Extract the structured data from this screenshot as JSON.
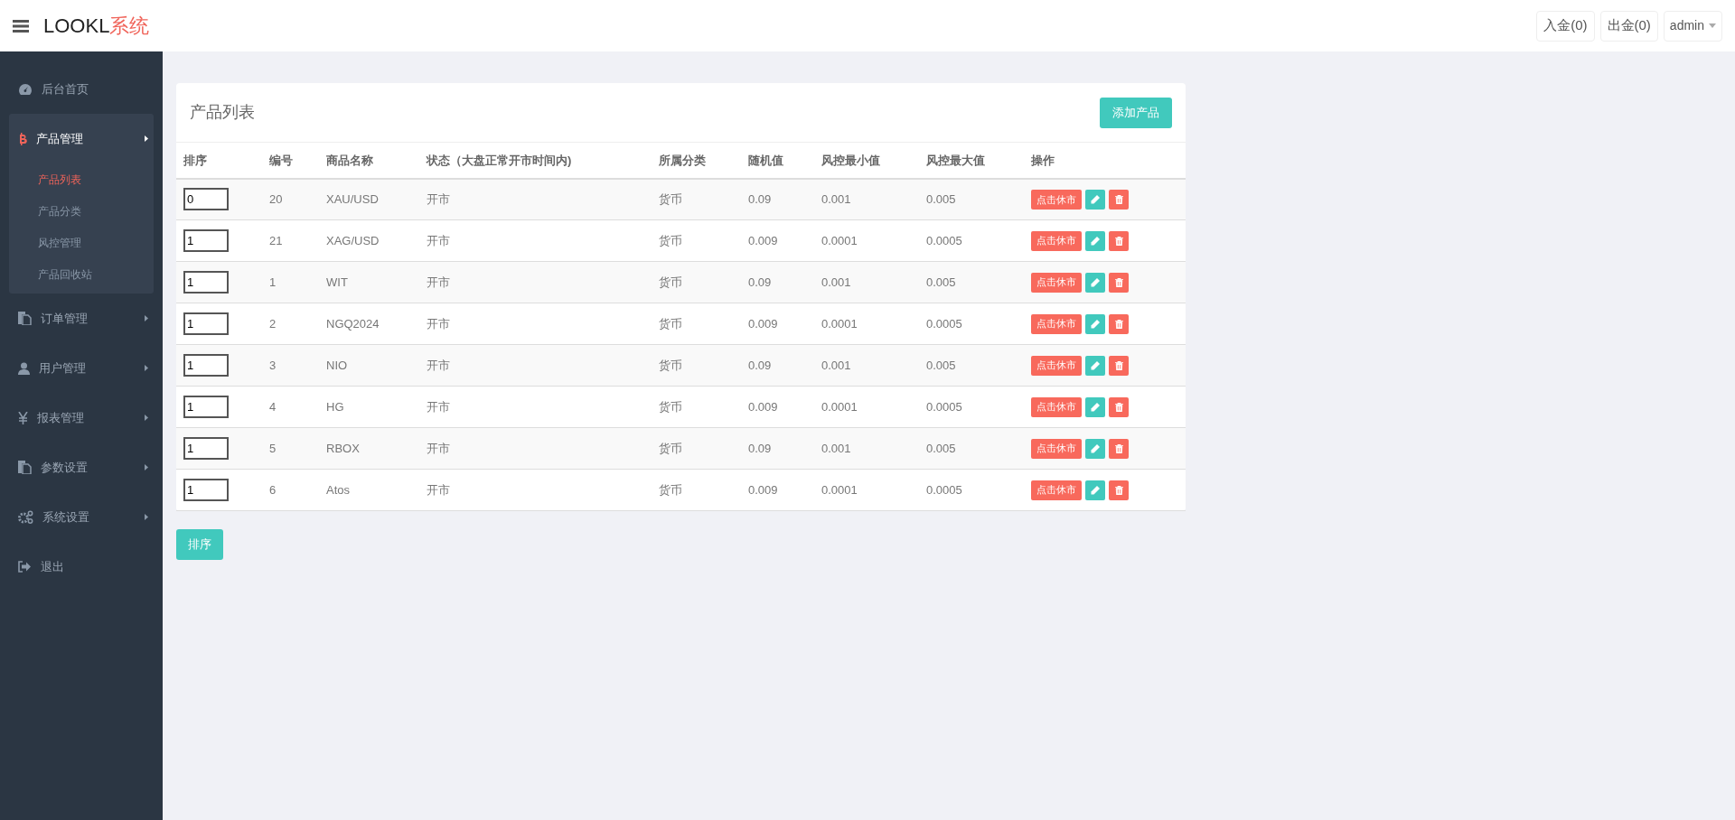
{
  "header": {
    "logo": "LOOKL",
    "logo_suffix": "系统",
    "buttons": [
      "入金(0)",
      "出金(0)"
    ],
    "user": "admin"
  },
  "sidebar": {
    "items": [
      {
        "kind": "dashboard",
        "label": "后台首页",
        "has_arrow": false,
        "expanded": false
      },
      {
        "kind": "bitcoin",
        "label": "产品管理",
        "has_arrow": true,
        "expanded": true,
        "children": [
          {
            "label": "产品列表",
            "selected": true
          },
          {
            "label": "产品分类",
            "selected": false
          },
          {
            "label": "风控管理",
            "selected": false
          },
          {
            "label": "产品回收站",
            "selected": false
          }
        ]
      },
      {
        "kind": "files",
        "label": "订单管理",
        "has_arrow": true,
        "expanded": false
      },
      {
        "kind": "user",
        "label": "用户管理",
        "has_arrow": true,
        "expanded": false
      },
      {
        "kind": "yen",
        "label": "报表管理",
        "has_arrow": true,
        "expanded": false
      },
      {
        "kind": "files",
        "label": "参数设置",
        "has_arrow": true,
        "expanded": false
      },
      {
        "kind": "gears",
        "label": "系统设置",
        "has_arrow": true,
        "expanded": false
      },
      {
        "kind": "logout",
        "label": "退出",
        "has_arrow": false,
        "expanded": false
      }
    ]
  },
  "panel": {
    "title": "产品列表",
    "add_button": "添加产品",
    "table": {
      "columns": [
        "排序",
        "编号",
        "商品名称",
        "状态（大盘正常开市时间内)",
        "所属分类",
        "随机值",
        "风控最小值",
        "风控最大值",
        "操作"
      ],
      "rows": [
        {
          "sort": "0",
          "id": "20",
          "name": "XAU/USD",
          "status": "开市",
          "category": "货币",
          "random": "0.09",
          "min": "0.001",
          "max": "0.005",
          "action": "点击休市"
        },
        {
          "sort": "1",
          "id": "21",
          "name": "XAG/USD",
          "status": "开市",
          "category": "货币",
          "random": "0.009",
          "min": "0.0001",
          "max": "0.0005",
          "action": "点击休市"
        },
        {
          "sort": "1",
          "id": "1",
          "name": "WIT",
          "status": "开市",
          "category": "货币",
          "random": "0.09",
          "min": "0.001",
          "max": "0.005",
          "action": "点击休市"
        },
        {
          "sort": "1",
          "id": "2",
          "name": "NGQ2024",
          "status": "开市",
          "category": "货币",
          "random": "0.009",
          "min": "0.0001",
          "max": "0.0005",
          "action": "点击休市"
        },
        {
          "sort": "1",
          "id": "3",
          "name": "NIO",
          "status": "开市",
          "category": "货币",
          "random": "0.09",
          "min": "0.001",
          "max": "0.005",
          "action": "点击休市"
        },
        {
          "sort": "1",
          "id": "4",
          "name": "HG",
          "status": "开市",
          "category": "货币",
          "random": "0.009",
          "min": "0.0001",
          "max": "0.0005",
          "action": "点击休市"
        },
        {
          "sort": "1",
          "id": "5",
          "name": "RBOX",
          "status": "开市",
          "category": "货币",
          "random": "0.09",
          "min": "0.001",
          "max": "0.005",
          "action": "点击休市"
        },
        {
          "sort": "1",
          "id": "6",
          "name": "Atos",
          "status": "开市",
          "category": "货币",
          "random": "0.009",
          "min": "0.0001",
          "max": "0.0005",
          "action": "点击休市"
        }
      ]
    }
  },
  "sort_button": "排序"
}
